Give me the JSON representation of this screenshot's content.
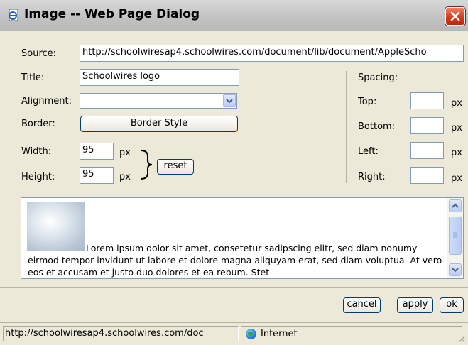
{
  "window": {
    "title": "Image -- Web Page Dialog"
  },
  "labels": {
    "source": "Source:",
    "title": "Title:",
    "alignment": "Alignment:",
    "border": "Border:",
    "width": "Width:",
    "height": "Height:",
    "spacing": "Spacing:",
    "top": "Top:",
    "bottom": "Bottom:",
    "left": "Left:",
    "right": "Right:",
    "px": "px"
  },
  "fields": {
    "source": "http://schoolwiresap4.schoolwires.com/document/lib/document/AppleScho",
    "title": "Schoolwires logo",
    "alignment": "",
    "width": "95",
    "height": "95",
    "spacing_top": "",
    "spacing_bottom": "",
    "spacing_left": "",
    "spacing_right": ""
  },
  "buttons": {
    "border_style": "Border Style",
    "reset": "reset",
    "cancel": "cancel",
    "apply": "apply",
    "ok": "ok"
  },
  "preview": {
    "text": "Lorem ipsum dolor sit amet, consetetur sadipscing elitr, sed diam nonumy eirmod tempor invidunt ut labore et dolore magna aliquyam erat, sed diam voluptua. At vero eos et accusam et justo duo dolores et ea rebum. Stet"
  },
  "statusbar": {
    "url": "http://schoolwiresap4.schoolwires.com/doc",
    "zone": "Internet"
  },
  "colors": {
    "title_bar": "#c8c8c8",
    "dialog_bg": "#ece9d8",
    "close_button": "#d03a1c",
    "field_border": "#7f9db9"
  }
}
